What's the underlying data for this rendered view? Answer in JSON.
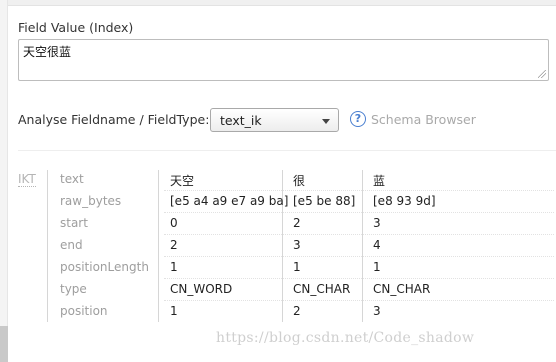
{
  "field_value": {
    "label": "Field Value (Index)",
    "text": "天空很蓝"
  },
  "analyse": {
    "label": "Analyse Fieldname / FieldType:",
    "selected": "text_ik",
    "schema_browser": "Schema Browser",
    "help_icon_glyph": "?"
  },
  "analysis": {
    "stage": "IKT",
    "row_labels": [
      "text",
      "raw_bytes",
      "start",
      "end",
      "positionLength",
      "type",
      "position"
    ],
    "tokens": [
      {
        "text": "天空",
        "raw_bytes": "[e5 a4 a9 e7 a9 ba]",
        "start": "0",
        "end": "2",
        "positionLength": "1",
        "type": "CN_WORD",
        "position": "1"
      },
      {
        "text": "很",
        "raw_bytes": "[e5 be 88]",
        "start": "2",
        "end": "3",
        "positionLength": "1",
        "type": "CN_CHAR",
        "position": "2"
      },
      {
        "text": "蓝",
        "raw_bytes": "[e8 93 9d]",
        "start": "3",
        "end": "4",
        "positionLength": "1",
        "type": "CN_CHAR",
        "position": "3"
      }
    ]
  },
  "watermark": "https://blog.csdn.net/Code_shadow"
}
